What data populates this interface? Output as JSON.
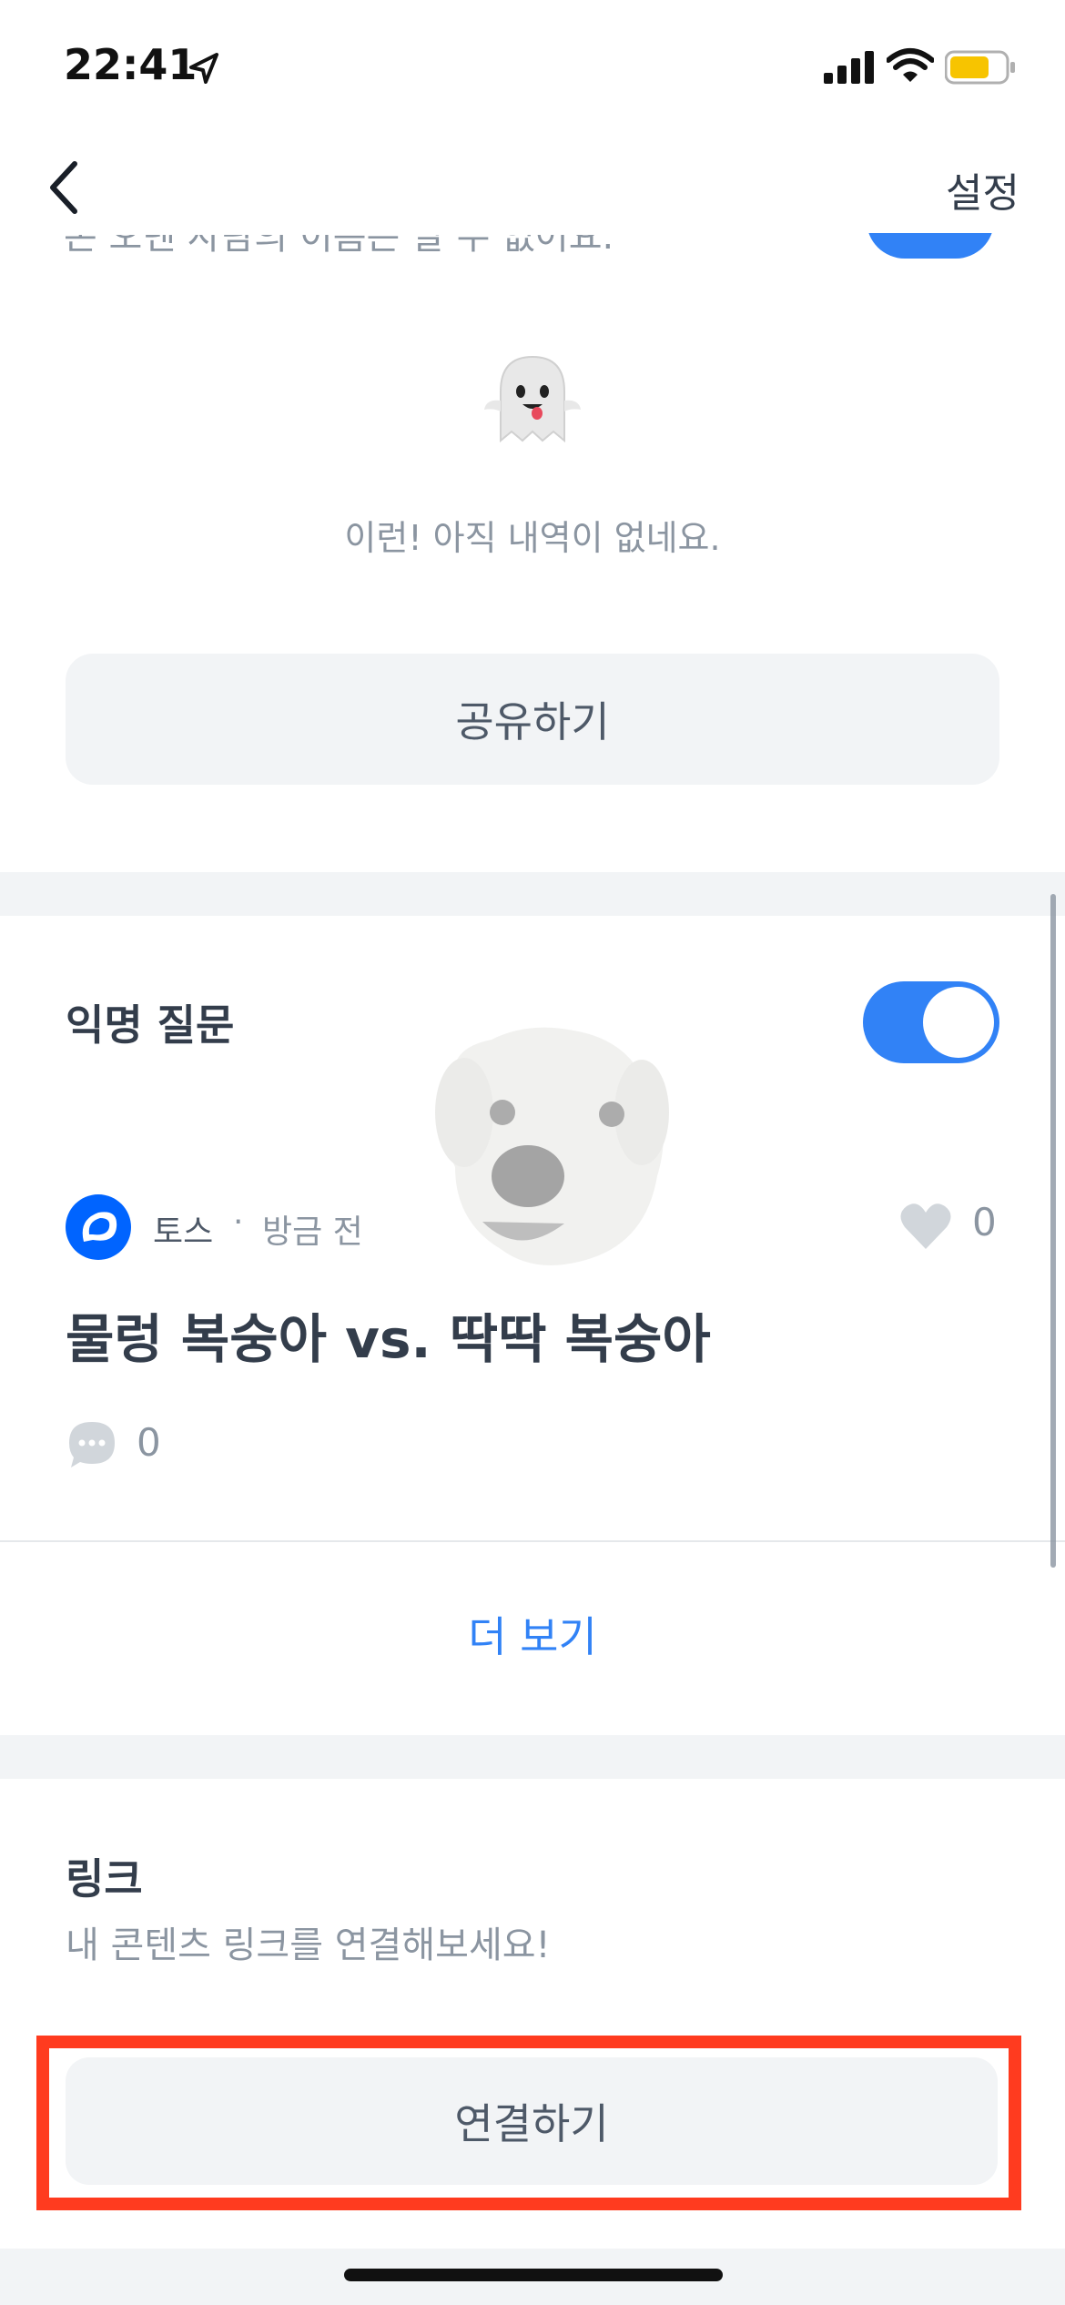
{
  "status_bar": {
    "time": "22:41"
  },
  "nav": {
    "settings_label": "설정"
  },
  "clipped_section": {
    "text": "온 오덴 사람의 이름은 알 수 없어요."
  },
  "empty_state": {
    "message": "이런! 아직 내역이 없네요."
  },
  "share_button": {
    "label": "공유하기"
  },
  "anonymous_question": {
    "title": "익명 질문",
    "toggle_on": true,
    "post": {
      "author": "토스",
      "separator": "·",
      "time": "방금 전",
      "likes": "0",
      "title": "물렁 복숭아 vs. 딱딱 복숭아",
      "comments": "0"
    },
    "more_label": "더 보기"
  },
  "link_section": {
    "title": "링크",
    "description": "내 콘텐츠 링크를 연결해보세요!",
    "connect_label": "연결하기"
  },
  "colors": {
    "accent": "#3182f6",
    "highlight": "#ff3b1f",
    "gray_bg": "#f2f4f6"
  }
}
